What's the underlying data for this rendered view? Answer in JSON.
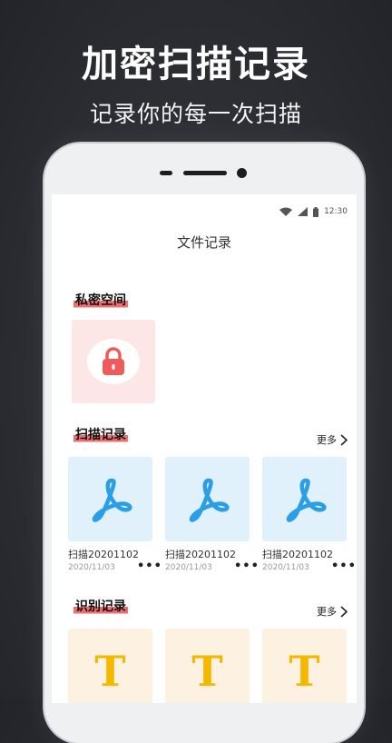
{
  "promo": {
    "title": "加密扫描记录",
    "subtitle": "记录你的每一次扫描"
  },
  "status_bar": {
    "time": "12:30",
    "icons": [
      "wifi-icon",
      "signal-icon",
      "battery-icon"
    ]
  },
  "nav": {
    "title": "文件记录"
  },
  "private_section": {
    "title": "私密空间",
    "icon": "lock-icon",
    "accent": "#f26d6d"
  },
  "scan_section": {
    "title": "扫描记录",
    "more_label": "更多",
    "items": [
      {
        "name": "扫描20201102",
        "date": "2020/11/03",
        "icon": "pdf-icon"
      },
      {
        "name": "扫描20201102",
        "date": "2020/11/03",
        "icon": "pdf-icon"
      },
      {
        "name": "扫描20201102",
        "date": "2020/11/03",
        "icon": "pdf-icon"
      }
    ]
  },
  "ocr_section": {
    "title": "识别记录",
    "more_label": "更多",
    "items": [
      {
        "glyph": "T",
        "icon": "text-icon"
      },
      {
        "glyph": "T",
        "icon": "text-icon"
      },
      {
        "glyph": "T",
        "icon": "text-icon"
      }
    ]
  },
  "more_menu_glyph": "•••"
}
